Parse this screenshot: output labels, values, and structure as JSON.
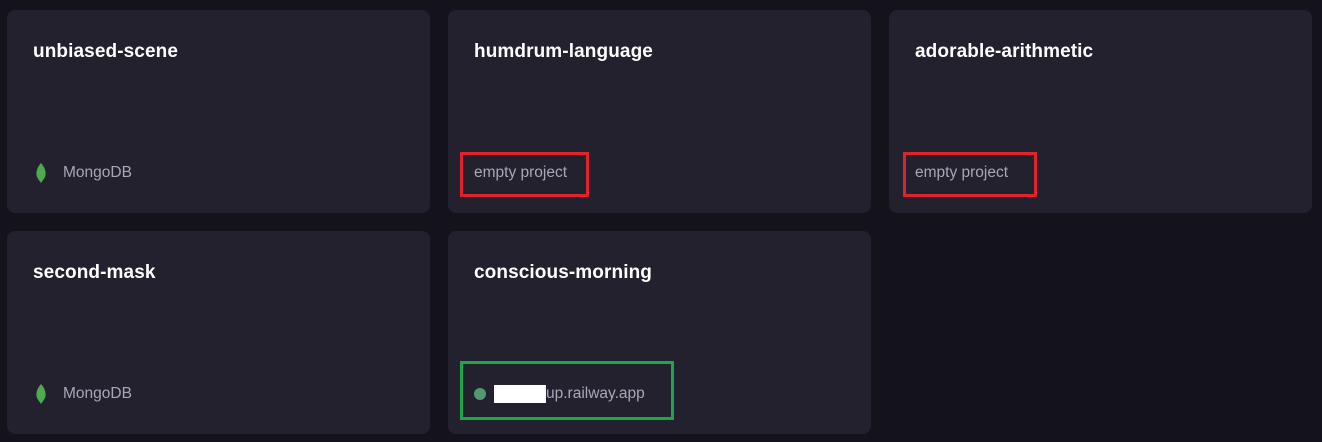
{
  "projects": [
    {
      "name": "unbiased-scene",
      "footer_type": "service",
      "service_icon": "mongodb-leaf-icon",
      "service_label": "MongoDB"
    },
    {
      "name": "humdrum-language",
      "footer_type": "empty",
      "empty_label": "empty project",
      "highlight_color": "#e0222c"
    },
    {
      "name": "adorable-arithmetic",
      "footer_type": "empty",
      "empty_label": "empty project",
      "highlight_color": "#e0222c"
    },
    {
      "name": "second-mask",
      "footer_type": "service",
      "service_icon": "mongodb-leaf-icon",
      "service_label": "MongoDB"
    },
    {
      "name": "conscious-morning",
      "footer_type": "deployment",
      "status_color": "#4f9a6f",
      "domain_suffix": "up.railway.app",
      "highlight_color": "#1fa44a"
    }
  ],
  "colors": {
    "background": "#14131b",
    "card": "#22212d",
    "mongodb_green": "#4fa94d"
  }
}
